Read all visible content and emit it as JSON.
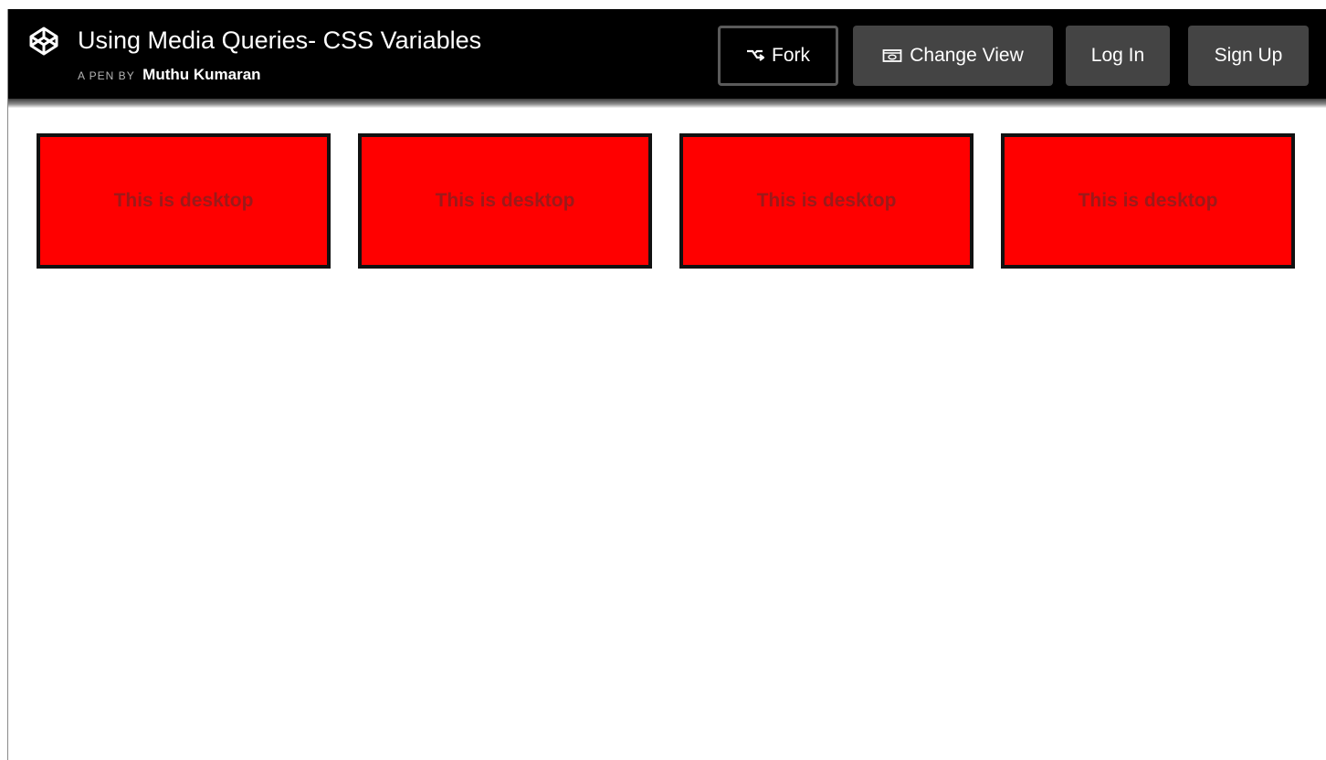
{
  "header": {
    "title": "Using Media Queries- CSS Variables",
    "byline_prefix": "A PEN BY",
    "author": "Muthu Kumaran",
    "logo_icon": "codepen-cube-icon"
  },
  "buttons": {
    "fork": "Fork",
    "fork_icon": "fork-icon",
    "change_view": "Change View",
    "change_view_icon": "view-icon",
    "log_in": "Log In",
    "sign_up": "Sign Up"
  },
  "cards": [
    {
      "label": "This is desktop"
    },
    {
      "label": "This is desktop"
    },
    {
      "label": "This is desktop"
    },
    {
      "label": "This is desktop"
    }
  ],
  "colors": {
    "header_bg": "#000000",
    "button_bg": "#444444",
    "card_bg": "#ff0000",
    "card_text": "#9b1a1a",
    "card_border": "#111111"
  }
}
